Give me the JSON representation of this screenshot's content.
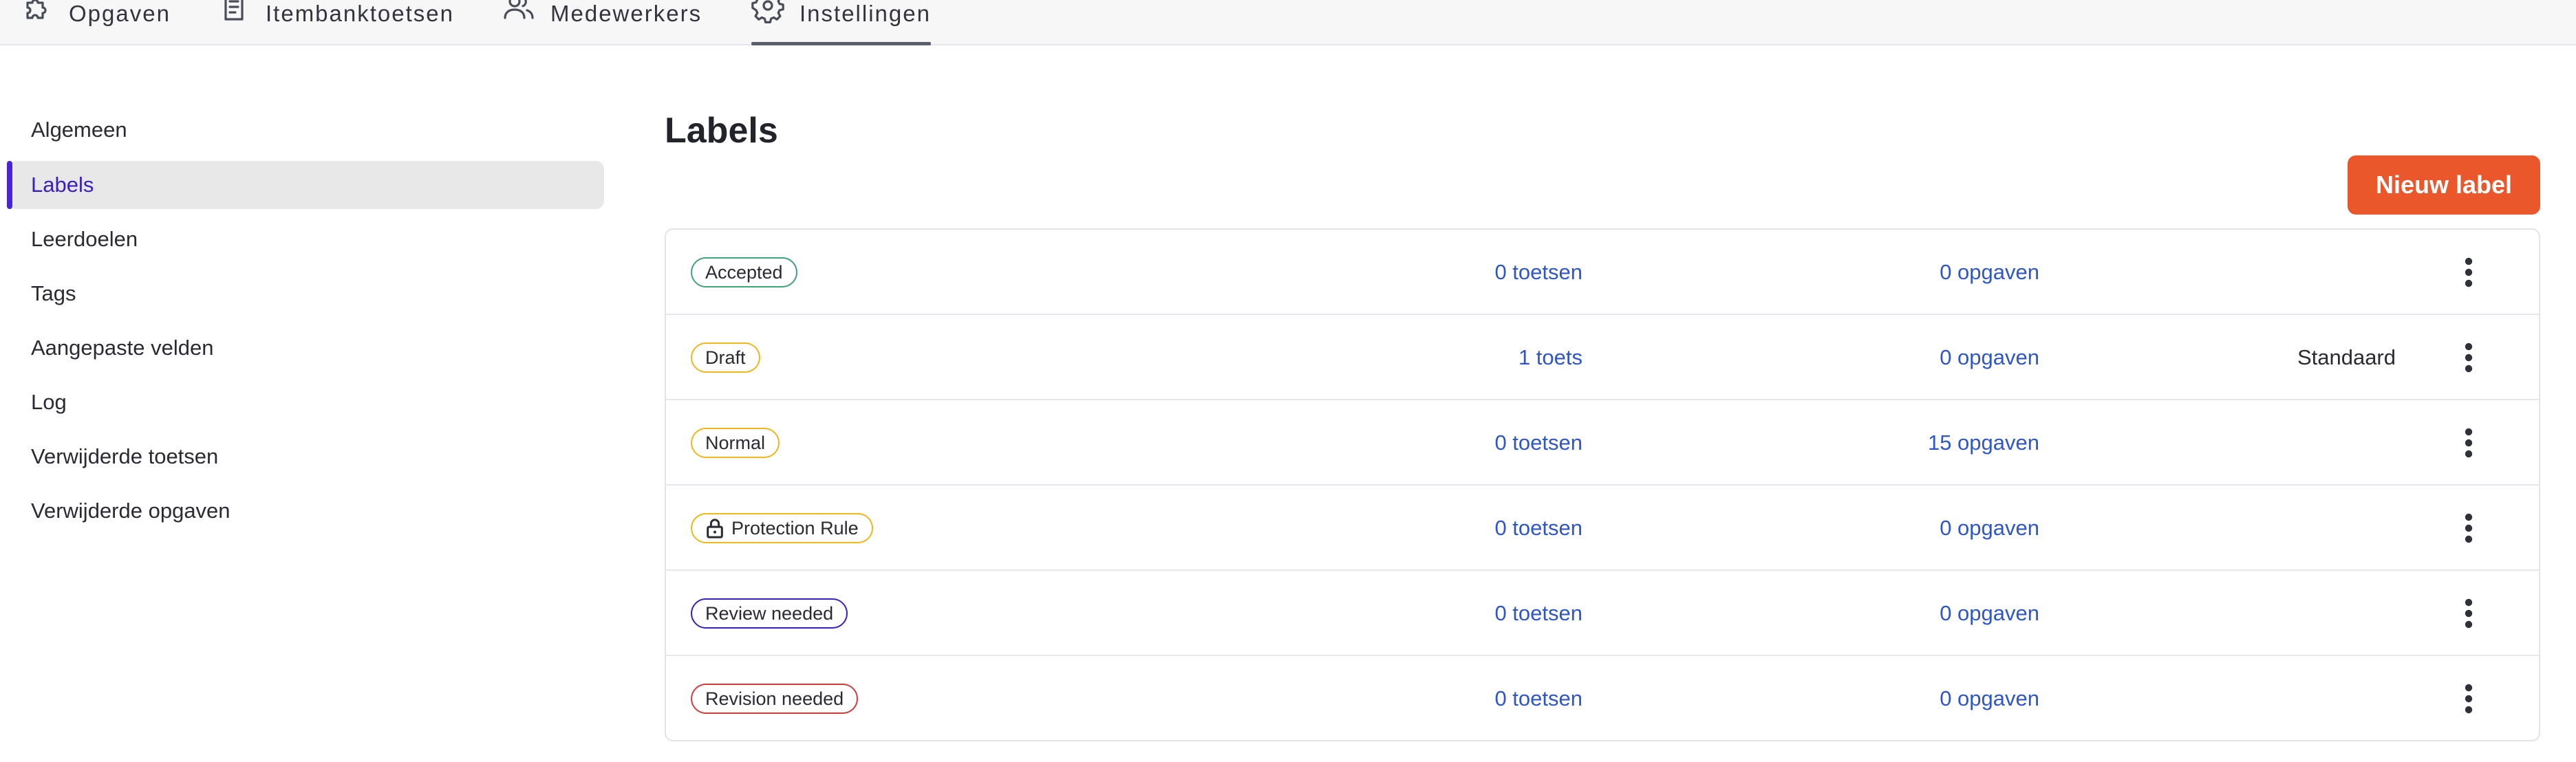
{
  "nav": {
    "items": [
      {
        "label": "Opgaven",
        "icon": "puzzle-icon"
      },
      {
        "label": "Itembanktoetsen",
        "icon": "document-icon"
      },
      {
        "label": "Medewerkers",
        "icon": "users-icon"
      },
      {
        "label": "Instellingen",
        "icon": "gear-icon",
        "active": true
      }
    ]
  },
  "sidebar": {
    "items": [
      {
        "label": "Algemeen"
      },
      {
        "label": "Labels",
        "active": true
      },
      {
        "label": "Leerdoelen"
      },
      {
        "label": "Tags"
      },
      {
        "label": "Aangepaste velden"
      },
      {
        "label": "Log"
      },
      {
        "label": "Verwijderde toetsen"
      },
      {
        "label": "Verwijderde opgaven"
      }
    ]
  },
  "main": {
    "title": "Labels",
    "new_button_label": "Nieuw label",
    "rows": [
      {
        "label": "Accepted",
        "color": "#3fa37a",
        "tests": "0 toetsen",
        "items": "0 opgaven",
        "default": ""
      },
      {
        "label": "Draft",
        "color": "#f2b61c",
        "tests": "1 toets",
        "items": "0 opgaven",
        "default": "Standaard"
      },
      {
        "label": "Normal",
        "color": "#f2b61c",
        "tests": "0 toetsen",
        "items": "15 opgaven",
        "default": ""
      },
      {
        "label": "Protection Rule",
        "color": "#f2b61c",
        "icon": "lock-icon",
        "tests": "0 toetsen",
        "items": "0 opgaven",
        "default": ""
      },
      {
        "label": "Review needed",
        "color": "#3a1ec2",
        "tests": "0 toetsen",
        "items": "0 opgaven",
        "default": ""
      },
      {
        "label": "Revision needed",
        "color": "#d43a3a",
        "tests": "0 toetsen",
        "items": "0 opgaven",
        "default": ""
      }
    ]
  },
  "colors": {
    "accent": "#4a25d8",
    "button": "#e9572a",
    "link": "#2f56c9"
  }
}
